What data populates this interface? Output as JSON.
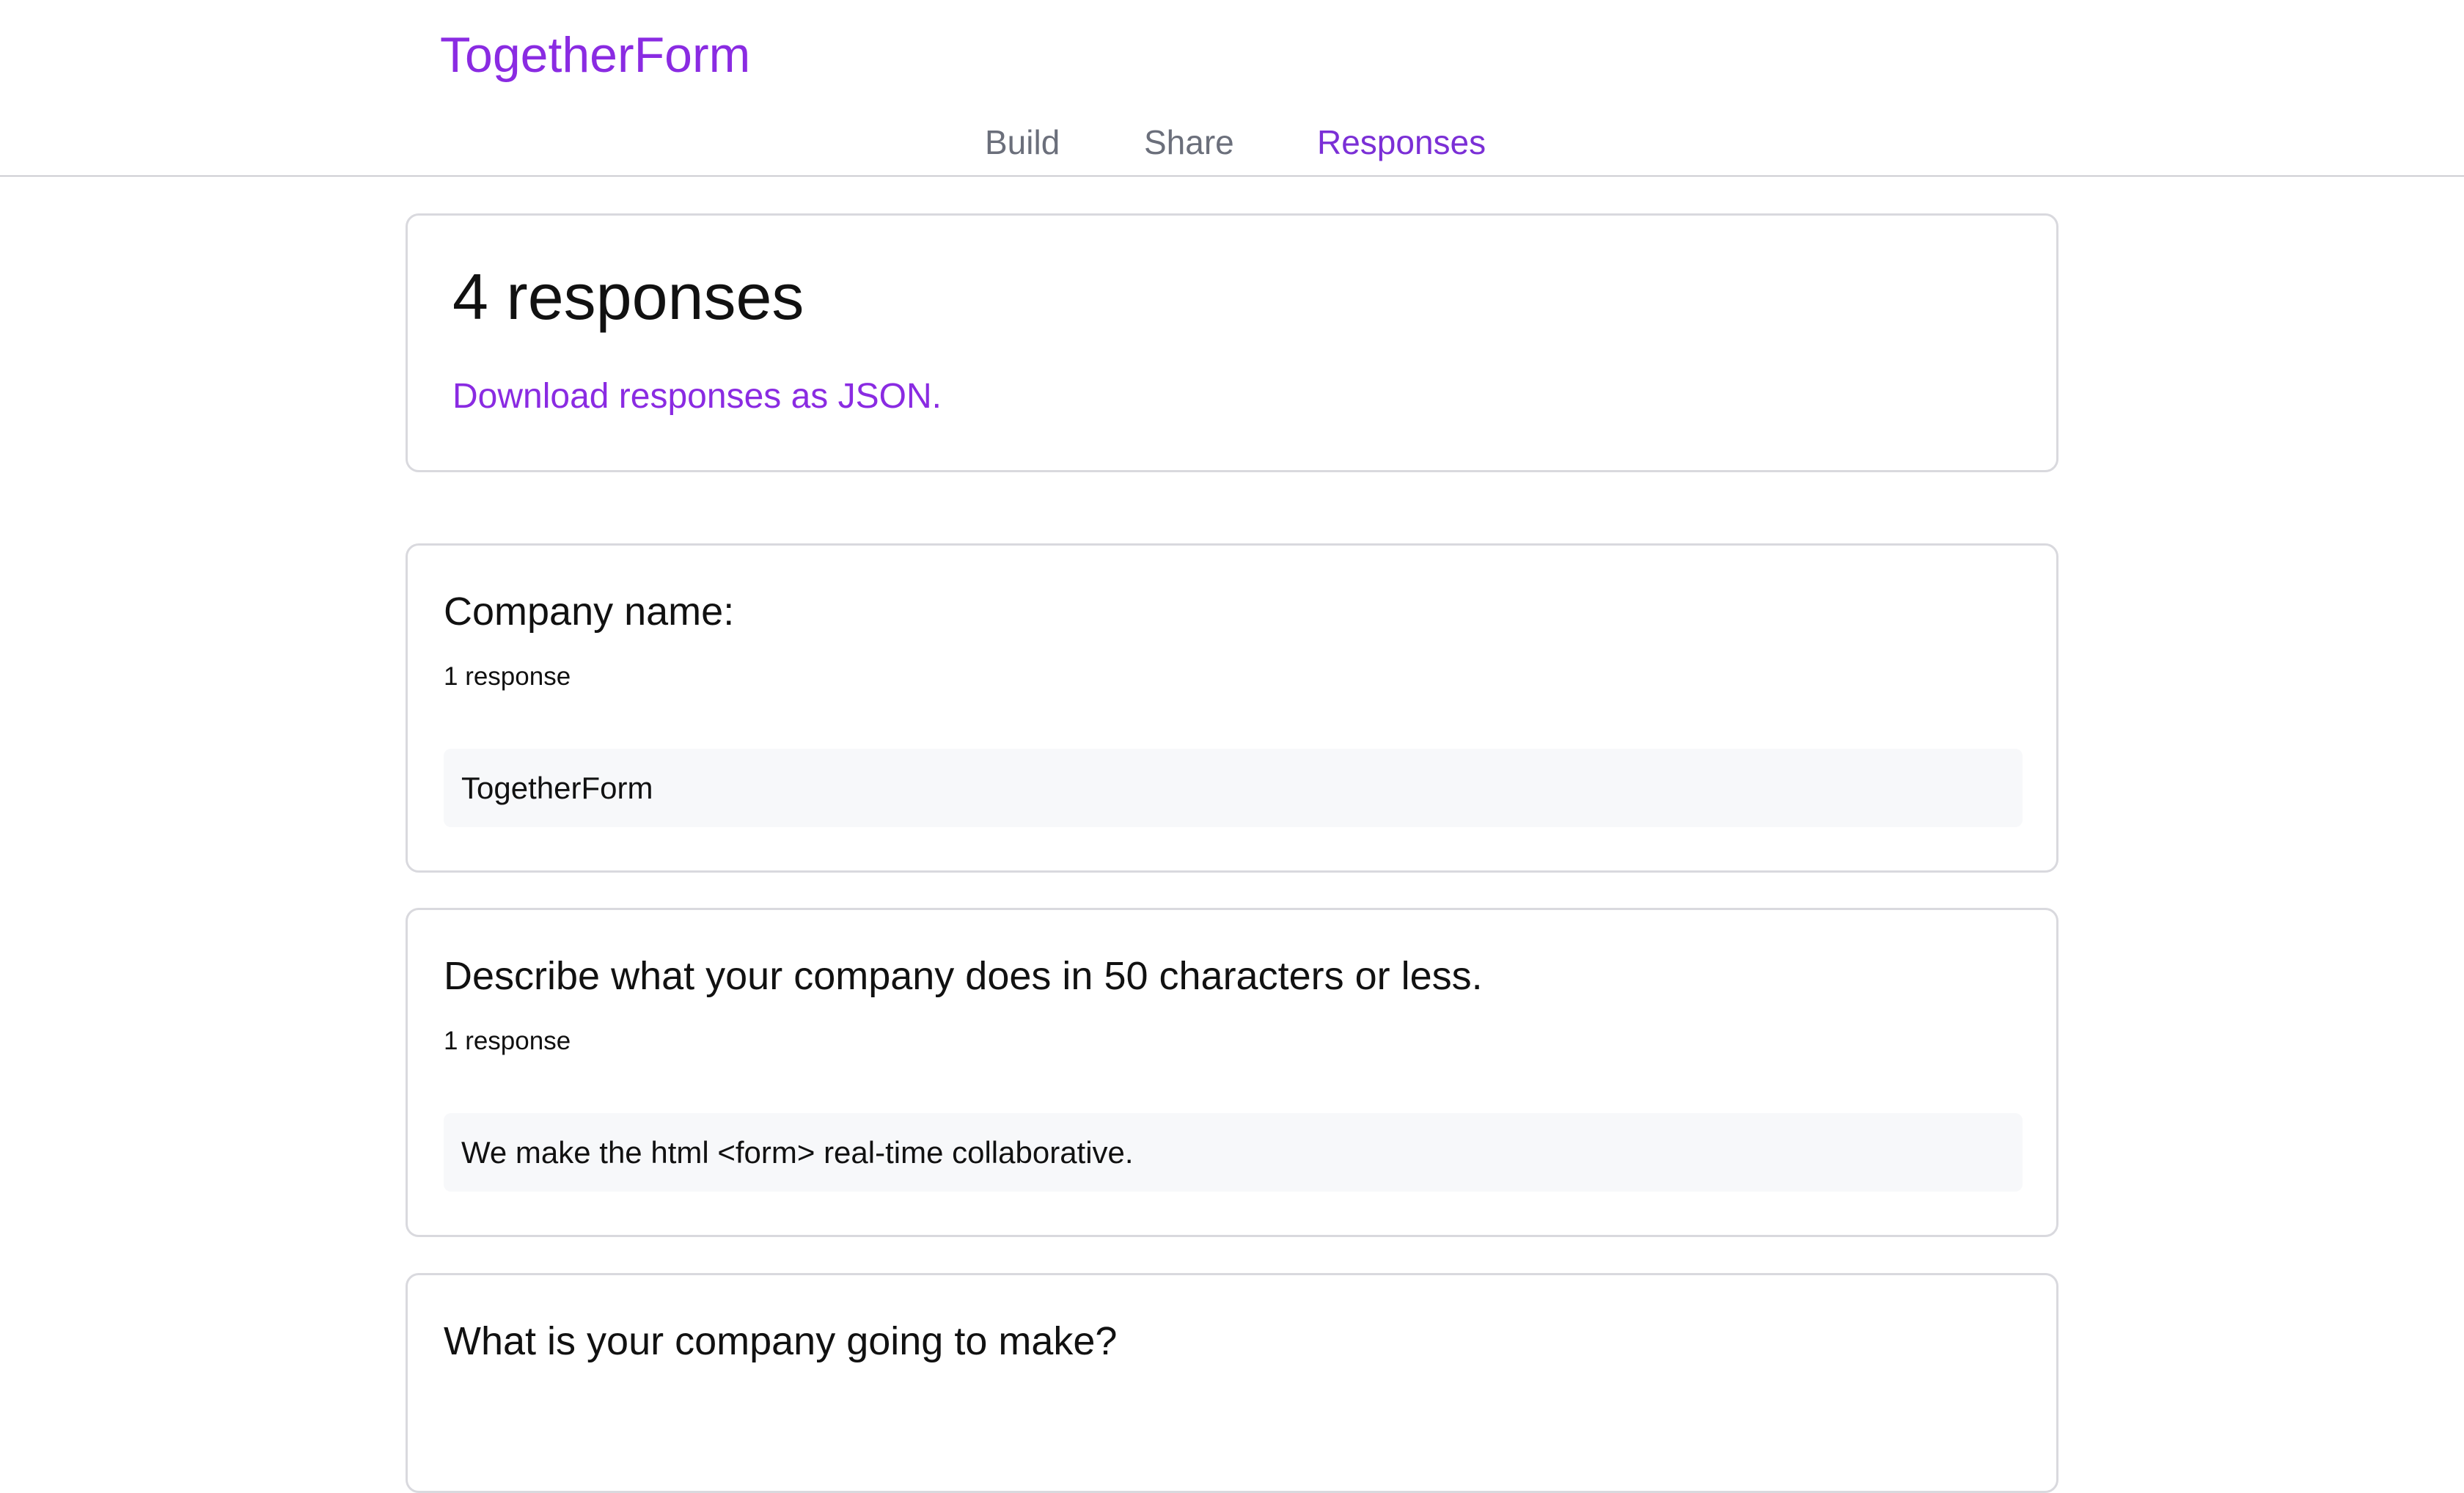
{
  "app": {
    "brand": "TogetherForm"
  },
  "nav": {
    "tabs": [
      {
        "label": "Build"
      },
      {
        "label": "Share"
      },
      {
        "label": "Responses",
        "active": true
      }
    ]
  },
  "summary": {
    "title": "4 responses",
    "download_link": "Download responses as JSON."
  },
  "questions": [
    {
      "title": "Company name:",
      "count": "1 response",
      "answers": [
        "TogetherForm"
      ]
    },
    {
      "title": "Describe what your company does in 50 characters or less.",
      "count": "1 response",
      "answers": [
        "We make the html <form> real-time collaborative."
      ]
    },
    {
      "title": "What is your company going to make?"
    }
  ],
  "colors": {
    "brand": "#8a2be2",
    "active_tab": "#7b2fd6",
    "inactive_tab": "#6b6f7b",
    "card_border": "#d9d9de",
    "answer_bg": "#f7f8fa"
  }
}
